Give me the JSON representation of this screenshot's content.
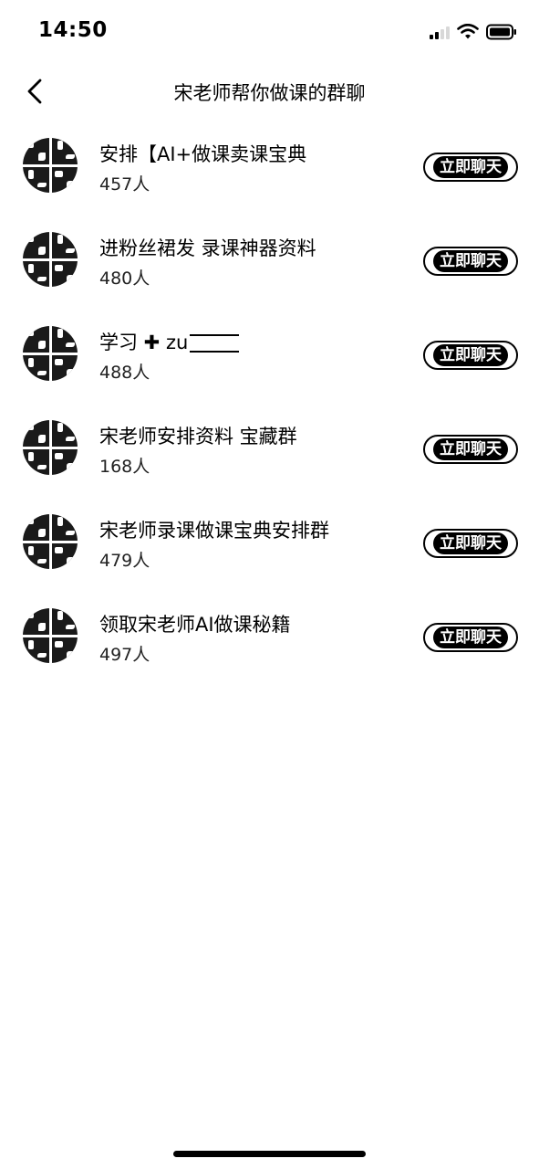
{
  "status_bar": {
    "time": "14:50",
    "icons": [
      "signal-icon",
      "wifi-icon",
      "battery-icon"
    ]
  },
  "nav": {
    "back_icon": "chevron-left-icon",
    "title": "宋老师帮你做课的群聊"
  },
  "groups": [
    {
      "name": "安排【AI+做课卖课宝典",
      "members": "457人",
      "button": "立即聊天"
    },
    {
      "name": "进粉丝裙发 录课神器资料",
      "members": "480人",
      "button": "立即聊天"
    },
    {
      "name": "学习 ✚ zu",
      "members": "488人",
      "button": "立即聊天"
    },
    {
      "name": "宋老师安排资料 宝藏群",
      "members": "168人",
      "button": "立即聊天"
    },
    {
      "name": "宋老师录课做课宝典安排群",
      "members": "479人",
      "button": "立即聊天"
    },
    {
      "name": "领取宋老师AI做课秘籍",
      "members": "497人",
      "button": "立即聊天"
    }
  ]
}
